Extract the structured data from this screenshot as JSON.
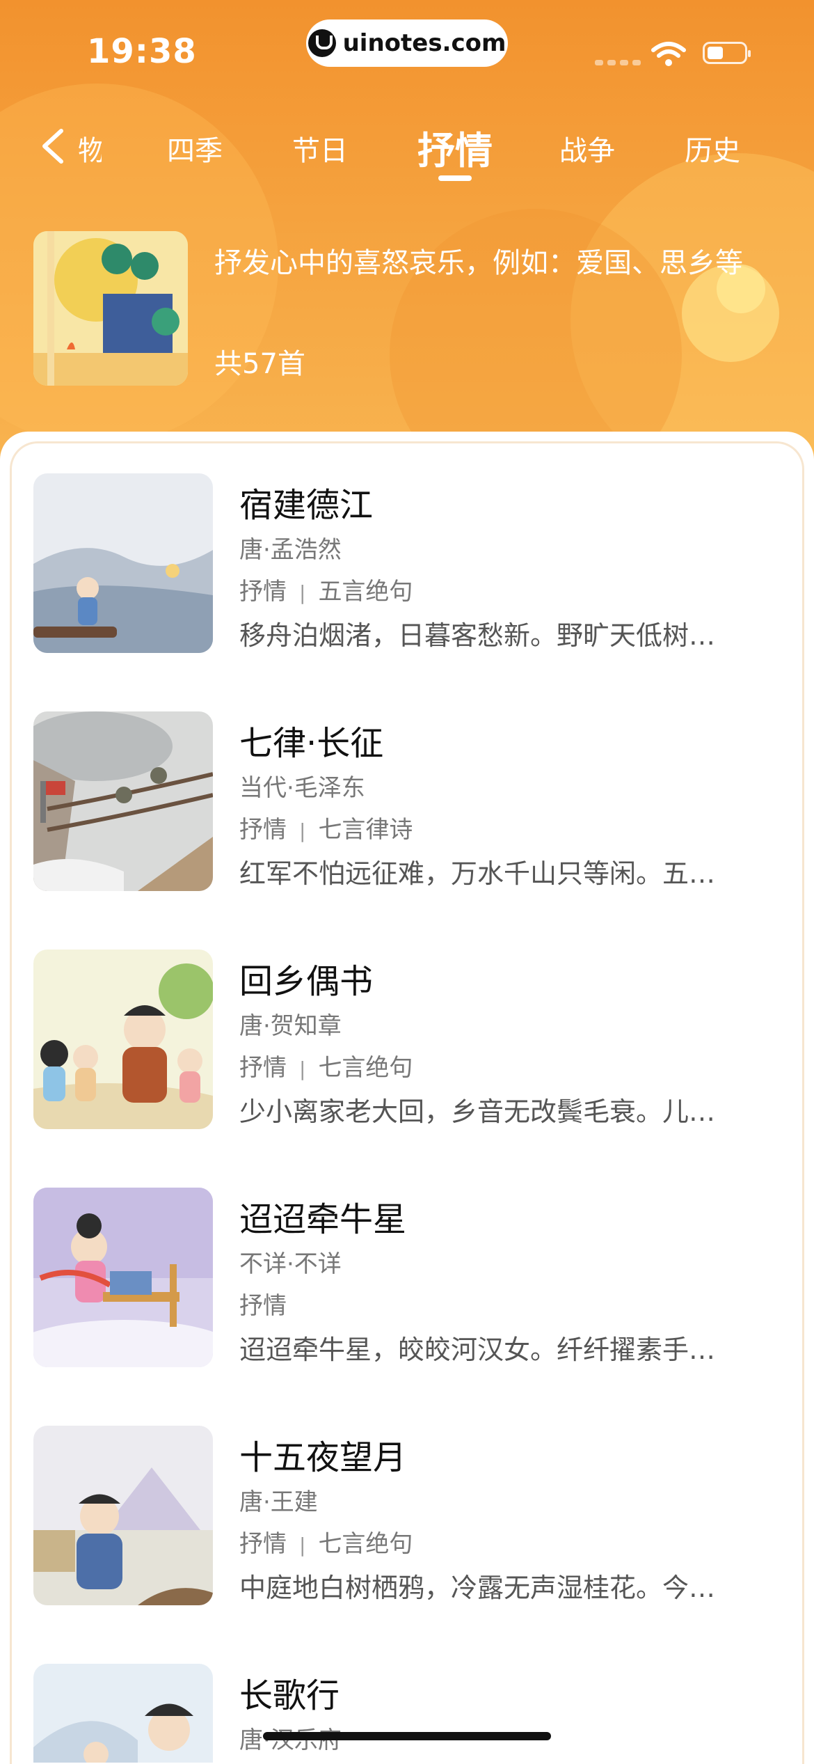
{
  "status_bar": {
    "time": "19:38",
    "watermark": "uinotes.com"
  },
  "tabs": [
    {
      "label": "物"
    },
    {
      "label": "四季"
    },
    {
      "label": "节日"
    },
    {
      "label": "抒情"
    },
    {
      "label": "战争"
    },
    {
      "label": "历史"
    }
  ],
  "active_tab": "抒情",
  "category": {
    "description": "抒发心中的喜怒哀乐，例如：爱国、思乡等",
    "count": "共57首"
  },
  "poems": [
    {
      "title": "宿建德江",
      "author": "唐·孟浩然",
      "tag1": "抒情",
      "tag2": "五言绝句",
      "excerpt": "移舟泊烟渚，日暮客愁新。野旷天低树…"
    },
    {
      "title": "七律·长征",
      "author": "当代·毛泽东",
      "tag1": "抒情",
      "tag2": "七言律诗",
      "excerpt": "红军不怕远征难，万水千山只等闲。五…"
    },
    {
      "title": "回乡偶书",
      "author": "唐·贺知章",
      "tag1": "抒情",
      "tag2": "七言绝句",
      "excerpt": "少小离家老大回，乡音无改鬓毛衰。儿…"
    },
    {
      "title": "迢迢牵牛星",
      "author": "不详·不详",
      "tag1": "抒情",
      "tag2": "",
      "excerpt": "迢迢牵牛星，皎皎河汉女。纤纤擢素手…"
    },
    {
      "title": "十五夜望月",
      "author": "唐·王建",
      "tag1": "抒情",
      "tag2": "七言绝句",
      "excerpt": "中庭地白树栖鸦，冷露无声湿桂花。今…"
    },
    {
      "title": "长歌行",
      "author": "唐·汉乐府",
      "tag1": "",
      "tag2": "",
      "excerpt": ""
    }
  ]
}
